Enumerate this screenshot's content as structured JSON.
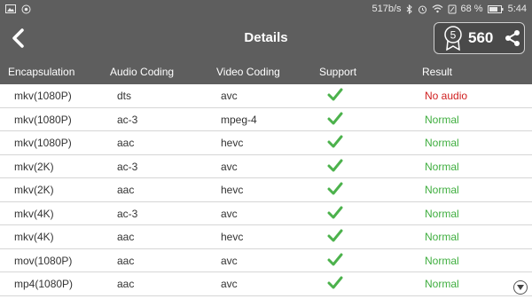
{
  "status_bar": {
    "net_speed": "517b/s",
    "battery_percent": "68 %",
    "time": "5:44",
    "icons": [
      "image-icon",
      "record-icon",
      "bluetooth-icon",
      "alarm-icon",
      "wifi-icon",
      "sim-icon",
      "battery-icon"
    ]
  },
  "header": {
    "title": "Details",
    "badge_level": "5",
    "score": "560",
    "icons": [
      "back-arrow-icon",
      "award-badge-icon",
      "share-icon"
    ]
  },
  "table": {
    "columns": [
      "Encapsulation",
      "Audio Coding",
      "Video Coding",
      "Support",
      "Result"
    ],
    "rows": [
      {
        "encapsulation": "mkv(1080P)",
        "audio": "dts",
        "video": "avc",
        "support": "check-icon",
        "result": "No audio",
        "status": "bad"
      },
      {
        "encapsulation": "mkv(1080P)",
        "audio": "ac-3",
        "video": "mpeg-4",
        "support": "check-icon",
        "result": "Normal",
        "status": "normal"
      },
      {
        "encapsulation": "mkv(1080P)",
        "audio": "aac",
        "video": "hevc",
        "support": "check-icon",
        "result": "Normal",
        "status": "normal"
      },
      {
        "encapsulation": "mkv(2K)",
        "audio": "ac-3",
        "video": "avc",
        "support": "check-icon",
        "result": "Normal",
        "status": "normal"
      },
      {
        "encapsulation": "mkv(2K)",
        "audio": "aac",
        "video": "hevc",
        "support": "check-icon",
        "result": "Normal",
        "status": "normal"
      },
      {
        "encapsulation": "mkv(4K)",
        "audio": "ac-3",
        "video": "avc",
        "support": "check-icon",
        "result": "Normal",
        "status": "normal"
      },
      {
        "encapsulation": "mkv(4K)",
        "audio": "aac",
        "video": "hevc",
        "support": "check-icon",
        "result": "Normal",
        "status": "normal"
      },
      {
        "encapsulation": "mov(1080P)",
        "audio": "aac",
        "video": "avc",
        "support": "check-icon",
        "result": "Normal",
        "status": "normal"
      },
      {
        "encapsulation": "mp4(1080P)",
        "audio": "aac",
        "video": "avc",
        "support": "check-icon",
        "result": "Normal",
        "status": "normal"
      }
    ]
  },
  "colors": {
    "header_bg": "#5e5e5e",
    "normal": "#3fae3f",
    "error": "#d02020",
    "check": "#4cb24c"
  },
  "scroll_indicator_icon": "chevron-down-circle-icon"
}
